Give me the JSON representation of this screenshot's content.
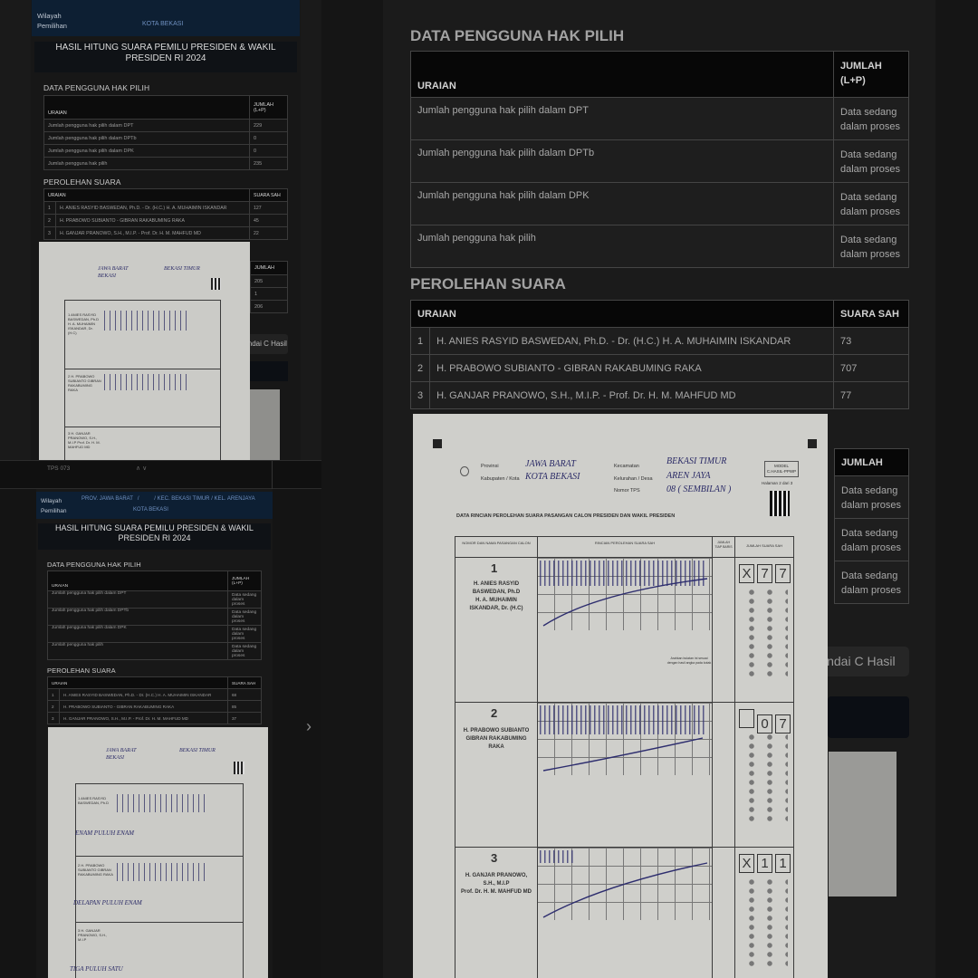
{
  "top_panel": {
    "wilayah_label": "Wilayah Pemilihan",
    "kota": "KOTA BEKASI",
    "header_title": "HASIL HITUNG SUARA PEMILU PRESIDEN & WAKIL PRESIDEN RI 2024",
    "section_dpt": "DATA PENGGUNA HAK PILIH",
    "col_uraian": "URAIAN",
    "col_jumlah": "JUMLAH (L+P)",
    "dpt_rows": [
      {
        "label": "Jumlah pengguna hak pilih dalam DPT",
        "value": "229"
      },
      {
        "label": "Jumlah pengguna hak pilih dalam DPTb",
        "value": "0"
      },
      {
        "label": "Jumlah pengguna hak pilih dalam DPK",
        "value": "0"
      },
      {
        "label": "Jumlah pengguna hak pilih",
        "value": "235"
      }
    ],
    "section_suara": "PEROLEHAN SUARA",
    "col_suara": "SUARA SAH",
    "candidates": [
      {
        "no": "1",
        "name": "H. ANIES RASYID BASWEDAN, Ph.D. - Dr. (H.C.) H. A. MUHAIMIN ISKANDAR",
        "votes": "127"
      },
      {
        "no": "2",
        "name": "H. PRABOWO SUBIANTO - GIBRAN RAKABUMING RAKA",
        "votes": "45"
      },
      {
        "no": "3",
        "name": "H. GANJAR PRANOWO, S.H., M.I.P. - Prof. Dr. H. M. MAHFUD MD",
        "votes": "22"
      }
    ],
    "behind_col": "JUMLAH",
    "behind_values": [
      "205",
      "1",
      "206"
    ],
    "behind_button": "indai C Hasil",
    "form": {
      "provinsi": "JAWA BARAT",
      "kota": "BEKASI",
      "kecamatan": "BEKASI TIMUR",
      "c1": "1 ANIES RASYID BASWEDAN, Ph.D H. A. MUHAIMIN ISKANDAR, Dr. (H.C)",
      "c2": "2 H. PRABOWO SUBIANTO GIBRAN RAKABUMING RAKA",
      "c3": "3 H. GANJAR PRANOWO, S.H., M.I.P Prof. Dr. H. M. MAHFUD MD"
    }
  },
  "mid_bar": {
    "tps": "TPS 073",
    "chevrons": "∧ ∨"
  },
  "lower_panel": {
    "wilayah_label": "Wilayah Pemilihan",
    "breadcrumb": [
      "PROV. JAWA BARAT",
      "/",
      "/",
      "KEC. BEKASI TIMUR",
      "/",
      "KEL. ARENJAYA"
    ],
    "kota": "KOTA BEKASI",
    "header_title": "HASIL HITUNG SUARA PEMILU PRESIDEN & WAKIL PRESIDEN RI 2024",
    "section_dpt": "DATA PENGGUNA HAK PILIH",
    "col_uraian": "URAIAN",
    "col_jumlah": "JUMLAH (L+P)",
    "dpt_rows": [
      {
        "label": "Jumlah pengguna hak pilih dalam DPT",
        "value": "Data sedang dalam proses"
      },
      {
        "label": "Jumlah pengguna hak pilih dalam DPTb",
        "value": "Data sedang dalam proses"
      },
      {
        "label": "Jumlah pengguna hak pilih dalam DPK",
        "value": "Data sedang dalam proses"
      },
      {
        "label": "Jumlah pengguna hak pilih",
        "value": "Data sedang dalam proses"
      }
    ],
    "section_suara": "PEROLEHAN SUARA",
    "col_suara": "SUARA SAH",
    "candidates": [
      {
        "no": "1",
        "name": "H. ANIES RASYID BASWEDAN, Ph.D. - Dr. (H.C.) H. A. MUHAIMIN ISKANDAR",
        "votes": "68"
      },
      {
        "no": "2",
        "name": "H. PRABOWO SUBIANTO - GIBRAN RAKABUMING RAKA",
        "votes": "85"
      },
      {
        "no": "3",
        "name": "H. GANJAR PRANOWO, S.H., M.I.P. - Prof. Dr. H. M. MAHFUD MD",
        "votes": "37"
      }
    ],
    "next_arrow": "›",
    "form": {
      "provinsi": "JAWA BARAT",
      "kota": "BEKASI",
      "kecamatan": "BEKASI TIMUR",
      "c1": "1 ANIES RASYID BASWEDAN, Ph.D",
      "c2": "2 H. PRABOWO SUBIANTO GIBRAN RAKABUMING RAKA",
      "c3": "3 H. GANJAR PRANOWO, S.H., M.I.P",
      "w1": "ENAM PULUH ENAM",
      "w2": "DELAPAN PULUH ENAM",
      "w3": "TIGA PULUH SATU"
    }
  },
  "right_panel": {
    "section_dpt": "DATA PENGGUNA HAK PILIH",
    "col_uraian": "URAIAN",
    "col_jumlah": "JUMLAH (L+P)",
    "dpt_rows": [
      {
        "label": "Jumlah pengguna hak pilih dalam DPT",
        "value": "Data sedang dalam proses"
      },
      {
        "label": "Jumlah pengguna hak pilih dalam DPTb",
        "value": "Data sedang dalam proses"
      },
      {
        "label": "Jumlah pengguna hak pilih dalam DPK",
        "value": "Data sedang dalam proses"
      },
      {
        "label": "Jumlah pengguna hak pilih",
        "value": "Data sedang dalam proses"
      }
    ],
    "section_suara": "PEROLEHAN SUARA",
    "col_suara": "SUARA SAH",
    "candidates": [
      {
        "no": "1",
        "name": "H. ANIES RASYID BASWEDAN, Ph.D. - Dr. (H.C.) H. A. MUHAIMIN ISKANDAR",
        "votes": "73"
      },
      {
        "no": "2",
        "name": "H. PRABOWO SUBIANTO - GIBRAN RAKABUMING RAKA",
        "votes": "707"
      },
      {
        "no": "3",
        "name": "H. GANJAR PRANOWO, S.H., M.I.P. - Prof. Dr. H. M. MAHFUD MD",
        "votes": "77"
      }
    ],
    "behind_col": "JUMLAH",
    "behind_values": [
      "Data sedang dalam proses",
      "Data sedang dalam proses",
      "Data sedang dalam proses"
    ],
    "behind_button": "indai C Hasil",
    "form": {
      "provinsi_label": "Provinsi",
      "provinsi": "JAWA BARAT",
      "kota_label": "Kabupaten / Kota",
      "kota": "KOTA BEKASI",
      "kecamatan_label": "Kecamatan",
      "kecamatan": "BEKASI TIMUR",
      "kelurahan_label": "Kelurahan / Desa",
      "kelurahan": "AREN JAYA",
      "tps_label": "Nomor TPS",
      "tps": "08 ( SEMBILAN )",
      "badge": "MODEL C.HASIL-PPWP",
      "halaman": "Halaman 2 dari 3",
      "title": "DATA RINCIAN PEROLEHAN SUARA PASANGAN CALON PRESIDEN DAN WAKIL PRESIDEN",
      "col_nomor": "NOMOR DAN NAMA PASANGAN CALON",
      "col_rincian": "RINCIAN PEROLEHAN SUARA SAH",
      "col_jumlah_tiap": "JUMLAH TIAP BARIS",
      "col_jumlah_suara": "JUMLAH SUARA SAH",
      "candidates": [
        {
          "no": "1",
          "name_lines": [
            "H. ANIES RASYID",
            "BASWEDAN, Ph.D",
            "H. A. MUHAIMIN",
            "ISKANDAR, Dr. (H.C)"
          ],
          "digits": [
            "X",
            "7",
            "7"
          ]
        },
        {
          "no": "2",
          "name_lines": [
            "H. PRABOWO SUBIANTO",
            "GIBRAN RAKABUMING",
            "RAKA"
          ],
          "digits": [
            "",
            "0",
            "7"
          ]
        },
        {
          "no": "3",
          "name_lines": [
            "H. GANJAR PRANOWO,",
            "S.H., M.I.P",
            "Prof. Dr. H. M. MAHFUD MD"
          ],
          "digits": [
            "X",
            "1",
            "1"
          ]
        }
      ],
      "note": "Arahkan bulatan ini sesuai dengan hasil angka pada kotak"
    }
  }
}
